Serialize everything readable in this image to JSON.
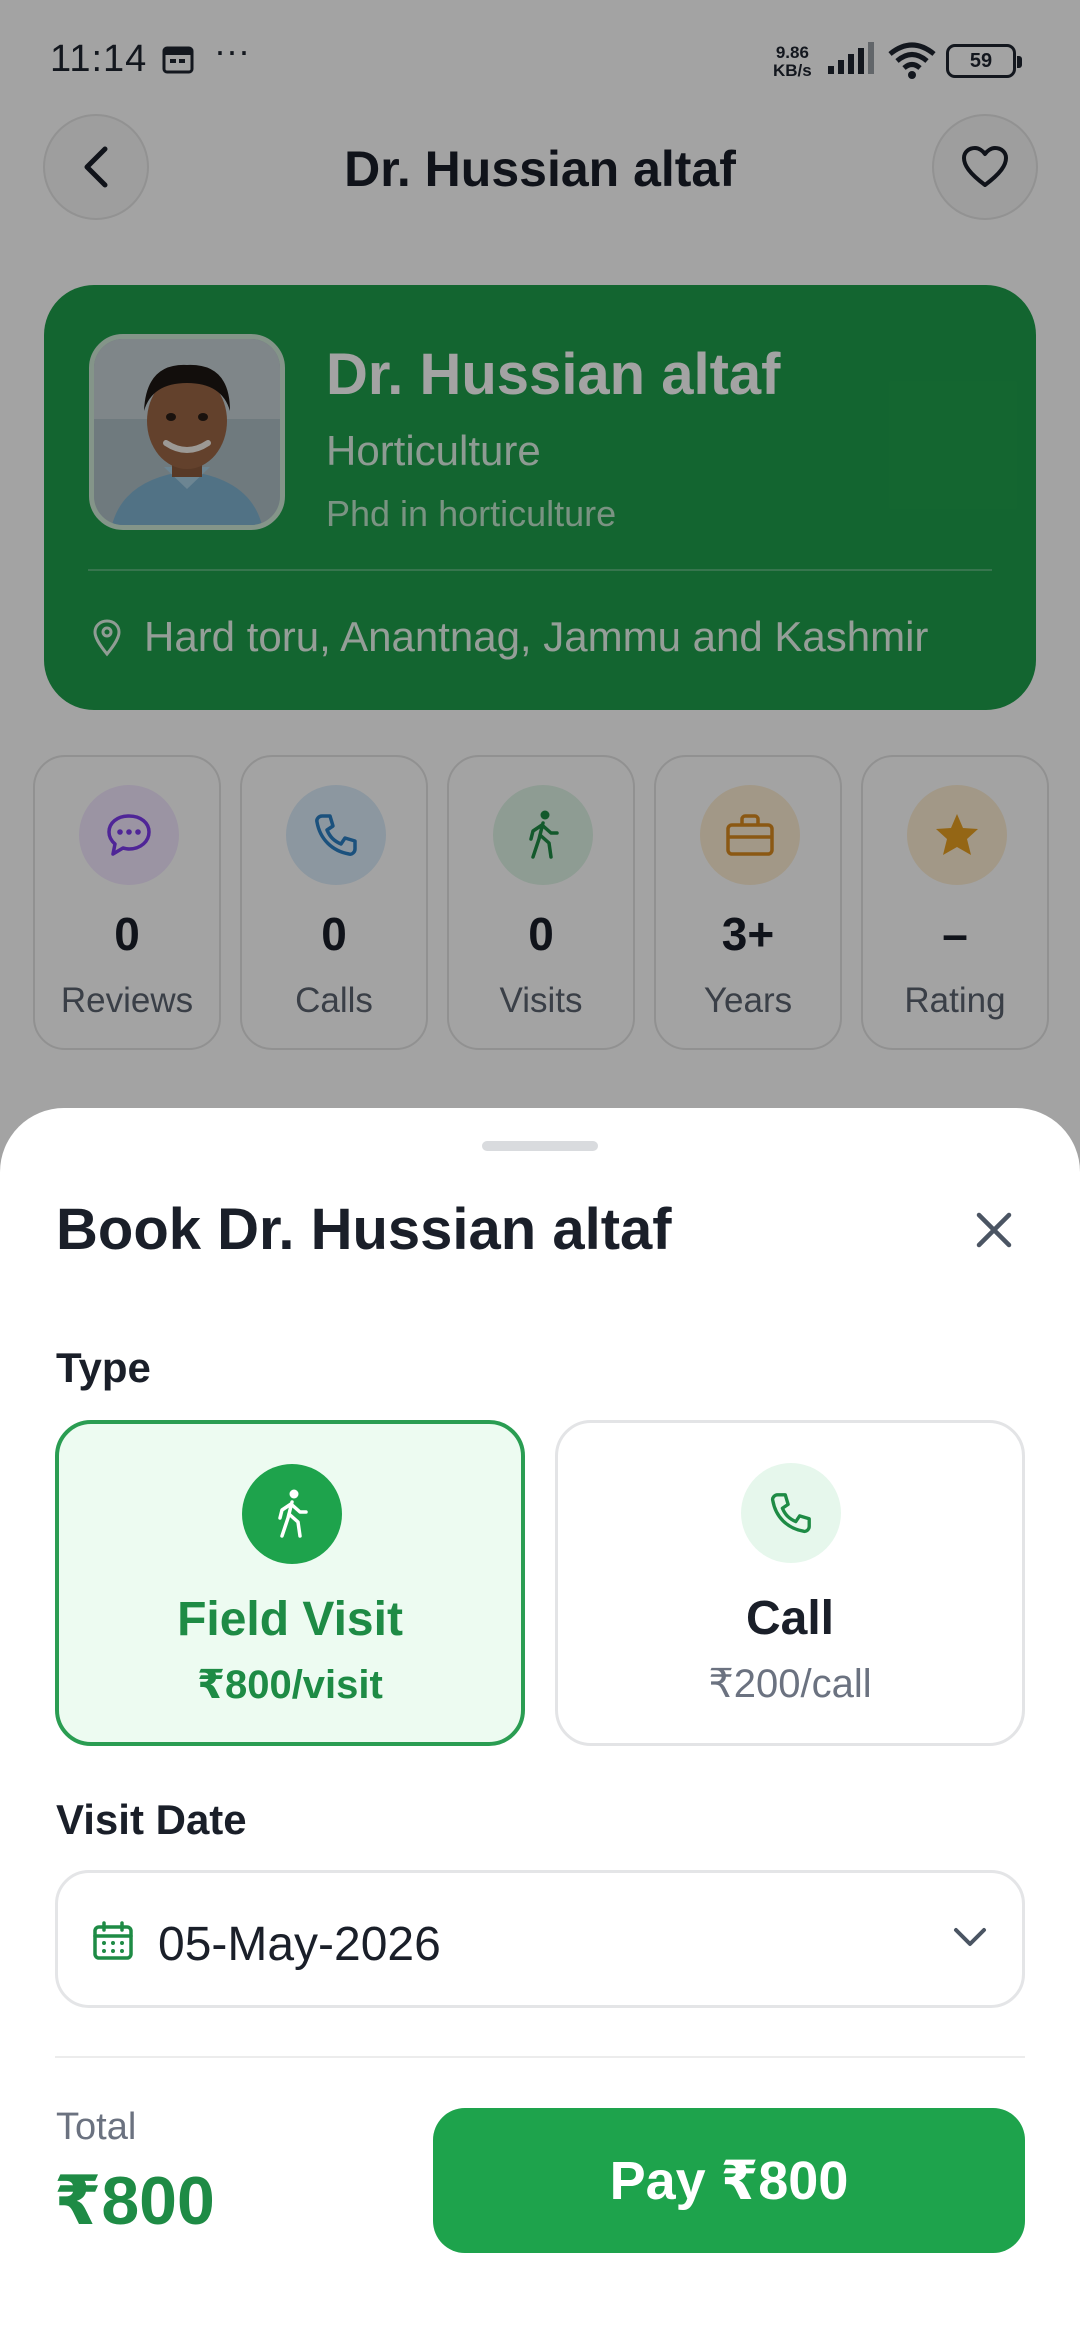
{
  "status_bar": {
    "time": "11:14",
    "more": "···",
    "net_speed_value": "9.86",
    "net_speed_unit": "KB/s",
    "battery": "59"
  },
  "header": {
    "title": "Dr. Hussian altaf"
  },
  "profile": {
    "name": "Dr. Hussian altaf",
    "specialization": "Horticulture",
    "degree": "Phd in horticulture",
    "location": "Hard toru, Anantnag, Jammu and Kashmir"
  },
  "stats": [
    {
      "value": "0",
      "label": "Reviews",
      "icon": "chat-icon",
      "color": "#7c3aed"
    },
    {
      "value": "0",
      "label": "Calls",
      "icon": "phone-icon",
      "color": "#2b7fc4"
    },
    {
      "value": "0",
      "label": "Visits",
      "icon": "walking-icon",
      "color": "#1e8b45"
    },
    {
      "value": "3+",
      "label": "Years",
      "icon": "briefcase-icon",
      "color": "#d98a1e"
    },
    {
      "value": "–",
      "label": "Rating",
      "icon": "star-icon",
      "color": "#d98a1e"
    }
  ],
  "sheet": {
    "title": "Book Dr. Hussian altaf",
    "type_label": "Type",
    "options": [
      {
        "name": "Field Visit",
        "price": "₹800/visit",
        "selected": true,
        "icon": "walking-icon"
      },
      {
        "name": "Call",
        "price": "₹200/call",
        "selected": false,
        "icon": "phone-icon"
      }
    ],
    "date_label": "Visit Date",
    "date_value": "05-May-2026",
    "total_label": "Total",
    "total_value": "₹800",
    "pay_label": "Pay ₹800"
  },
  "colors": {
    "brand_green": "#1ea34c",
    "selected_bg": "#edfbf1",
    "overlay": "rgba(0,0,0,0.36)"
  }
}
